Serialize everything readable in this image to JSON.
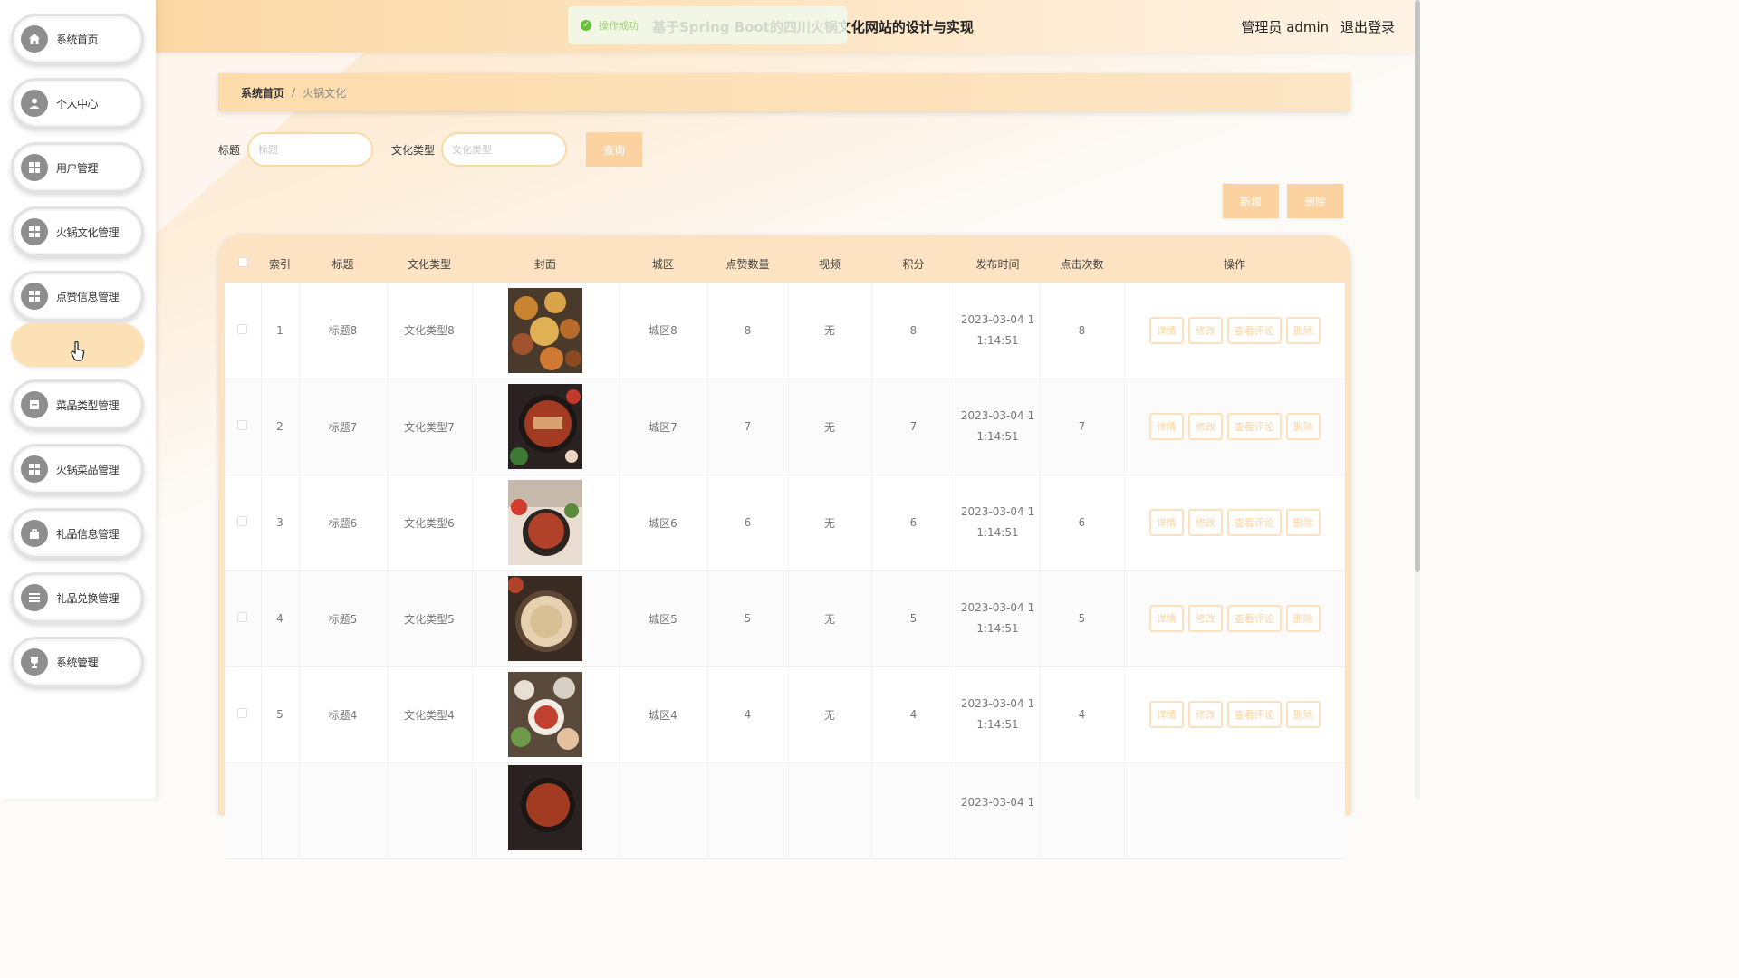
{
  "sidebar": {
    "items": [
      {
        "label": "系统首页",
        "icon": "home-icon"
      },
      {
        "label": "个人中心",
        "icon": "user-icon"
      },
      {
        "label": "用户管理",
        "icon": "grid-icon"
      },
      {
        "label": "火锅文化管理",
        "icon": "grid-icon"
      },
      {
        "label": "点赞信息管理",
        "icon": "grid-icon"
      },
      {
        "label": "",
        "icon": ""
      },
      {
        "label": "菜品类型管理",
        "icon": "doc-icon"
      },
      {
        "label": "火锅菜品管理",
        "icon": "grid-icon"
      },
      {
        "label": "礼品信息管理",
        "icon": "bag-icon"
      },
      {
        "label": "礼品兑换管理",
        "icon": "list-icon"
      },
      {
        "label": "系统管理",
        "icon": "trophy-icon"
      }
    ]
  },
  "header": {
    "title": "基于Spring Boot的四川火锅文化网站的设计与实现",
    "toast": "操作成功",
    "user": "管理员 admin",
    "logout": "退出登录"
  },
  "breadcrumb": {
    "home": "系统首页",
    "sep": "/",
    "current": "火锅文化"
  },
  "search": {
    "title_label": "标题",
    "title_placeholder": "标题",
    "type_label": "文化类型",
    "type_placeholder": "文化类型",
    "query": "查询"
  },
  "actions": {
    "add": "新增",
    "delete": "删除"
  },
  "table": {
    "headers": [
      "",
      "索引",
      "标题",
      "文化类型",
      "封面",
      "城区",
      "点赞数量",
      "视频",
      "积分",
      "发布时间",
      "点击次数",
      "操作"
    ],
    "ops": [
      "详情",
      "修改",
      "查看评论",
      "删除"
    ],
    "rows": [
      {
        "index": "1",
        "title": "标题8",
        "type": "文化类型8",
        "district": "城区8",
        "likes": "8",
        "video": "无",
        "points": "8",
        "time1": "2023-03-04 1",
        "time2": "1:14:51",
        "clicks": "8"
      },
      {
        "index": "2",
        "title": "标题7",
        "type": "文化类型7",
        "district": "城区7",
        "likes": "7",
        "video": "无",
        "points": "7",
        "time1": "2023-03-04 1",
        "time2": "1:14:51",
        "clicks": "7"
      },
      {
        "index": "3",
        "title": "标题6",
        "type": "文化类型6",
        "district": "城区6",
        "likes": "6",
        "video": "无",
        "points": "6",
        "time1": "2023-03-04 1",
        "time2": "1:14:51",
        "clicks": "6"
      },
      {
        "index": "4",
        "title": "标题5",
        "type": "文化类型5",
        "district": "城区5",
        "likes": "5",
        "video": "无",
        "points": "5",
        "time1": "2023-03-04 1",
        "time2": "1:14:51",
        "clicks": "5"
      },
      {
        "index": "5",
        "title": "标题4",
        "type": "文化类型4",
        "district": "城区4",
        "likes": "4",
        "video": "无",
        "points": "4",
        "time1": "2023-03-04 1",
        "time2": "1:14:51",
        "clicks": "4"
      },
      {
        "index": "",
        "title": "",
        "type": "",
        "district": "",
        "likes": "",
        "video": "",
        "points": "",
        "time1": "2023-03-04 1",
        "time2": "",
        "clicks": ""
      }
    ]
  },
  "colors": {
    "accent": "#fcd3a0",
    "header": "#fbd7a4",
    "success": "#67c23a"
  }
}
